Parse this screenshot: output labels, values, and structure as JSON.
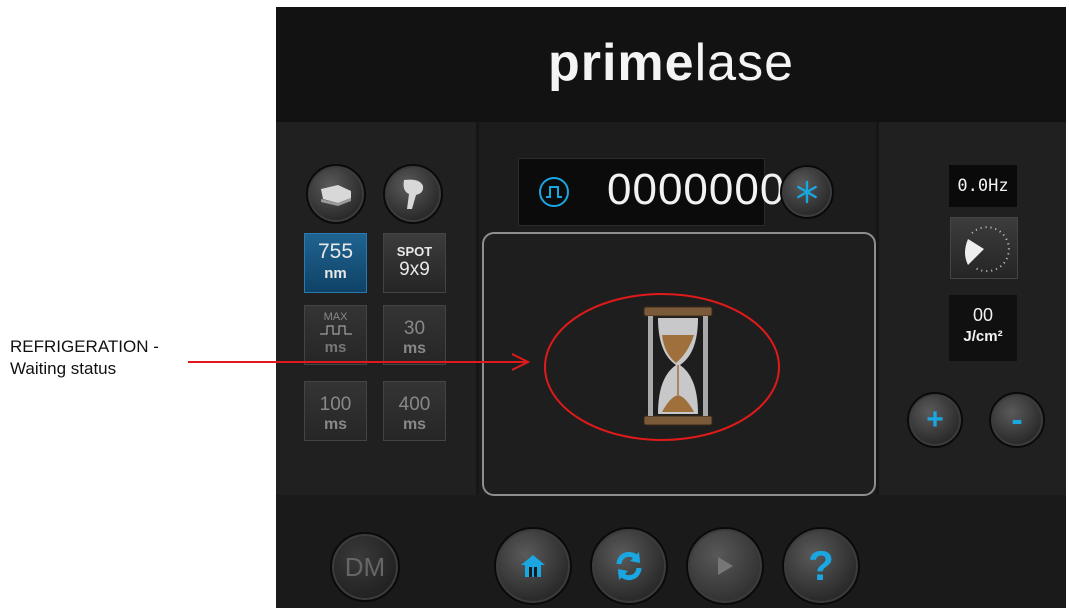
{
  "annotation": {
    "label_line1": "REFRIGERATION  -",
    "label_line2": "Waiting status",
    "color": "#e01a1a"
  },
  "logo": {
    "bold": "prime",
    "light": "lase"
  },
  "left_panel": {
    "icons": [
      "handpiece-shoe-icon",
      "handpiece-gun-icon"
    ],
    "wavelength": {
      "value": "755",
      "unit": "nm"
    },
    "spot": {
      "label": "SPOT",
      "value": "9x9"
    },
    "max_mode": {
      "label": "MAX",
      "unit": "ms"
    },
    "pulse_30": {
      "value": "30",
      "unit": "ms"
    },
    "pulse_100": {
      "value": "100",
      "unit": "ms"
    },
    "pulse_400": {
      "value": "400",
      "unit": "ms"
    }
  },
  "counter": {
    "value": "0000000",
    "pulse_icon": "pulse-icon",
    "snow_icon": "snowflake-icon"
  },
  "status": {
    "icon": "hourglass-icon"
  },
  "right_panel": {
    "frequency": "0.0Hz",
    "fluence": {
      "value": "00",
      "unit": "J/cm²"
    },
    "plus_label": "+",
    "minus_label": "-"
  },
  "footer": {
    "dm_label": "DM",
    "help_label": "?"
  },
  "colors": {
    "active_blue": "#1f6491",
    "accent_cyan": "#1aa6e0",
    "highlight_red": "#e01a1a"
  }
}
